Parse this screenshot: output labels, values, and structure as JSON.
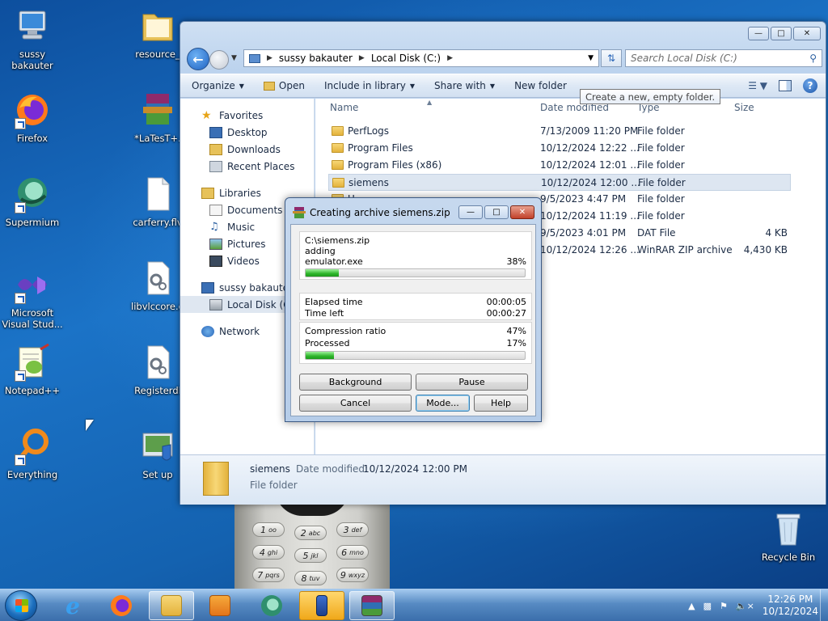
{
  "desktop": {
    "icons": [
      {
        "label": "sussy bakauter",
        "icon": "computer-icon"
      },
      {
        "label": "resource_",
        "icon": "folder-icon"
      },
      {
        "label": "Firefox",
        "icon": "firefox-icon"
      },
      {
        "label": "*LaTesT+.",
        "icon": "winrar-archive-icon"
      },
      {
        "label": "Supermium",
        "icon": "supermium-icon"
      },
      {
        "label": "carferry.flv",
        "icon": "file-icon"
      },
      {
        "label": "Microsoft Visual Stud...",
        "icon": "visual-studio-icon"
      },
      {
        "label": "libvlccore.d",
        "icon": "dll-file-icon"
      },
      {
        "label": "Notepad++",
        "icon": "notepadpp-icon"
      },
      {
        "label": "Registerdl",
        "icon": "dll-file-icon"
      },
      {
        "label": "Everything",
        "icon": "everything-icon"
      },
      {
        "label": "Set up",
        "icon": "setup-icon"
      },
      {
        "label": "Recycle Bin",
        "icon": "recycle-bin-icon"
      }
    ]
  },
  "explorer": {
    "address": {
      "crumbs": [
        "sussy bakauter",
        "Local Disk (C:)"
      ]
    },
    "search_placeholder": "Search Local Disk (C:)",
    "toolbar": {
      "organize": "Organize",
      "open": "Open",
      "include": "Include in library",
      "share": "Share with",
      "new_folder": "New folder"
    },
    "tooltip": "Create a new, empty folder.",
    "nav": {
      "favorites": "Favorites",
      "desktop": "Desktop",
      "downloads": "Downloads",
      "recent": "Recent Places",
      "libraries": "Libraries",
      "documents": "Documents",
      "music": "Music",
      "pictures": "Pictures",
      "videos": "Videos",
      "computer": "sussy bakauter",
      "localdisk": "Local Disk (C:",
      "network": "Network"
    },
    "columns": {
      "name": "Name",
      "date": "Date modified",
      "type": "Type",
      "size": "Size"
    },
    "files": [
      {
        "name": "PerfLogs",
        "date": "7/13/2009 11:20 PM",
        "type": "File folder",
        "size": ""
      },
      {
        "name": "Program Files",
        "date": "10/12/2024 12:22 ...",
        "type": "File folder",
        "size": ""
      },
      {
        "name": "Program Files (x86)",
        "date": "10/12/2024 12:01 ...",
        "type": "File folder",
        "size": ""
      },
      {
        "name": "siemens",
        "date": "10/12/2024 12:00 ...",
        "type": "File folder",
        "size": ""
      },
      {
        "name": "U",
        "date": "9/5/2023 4:47 PM",
        "type": "File folder",
        "size": ""
      },
      {
        "name": "",
        "date": "10/12/2024 11:19 ...",
        "type": "File folder",
        "size": ""
      },
      {
        "name": "",
        "date": "9/5/2023 4:01 PM",
        "type": "DAT File",
        "size": "4 KB"
      },
      {
        "name": "",
        "date": "10/12/2024 12:26 ...",
        "type": "WinRAR ZIP archive",
        "size": "4,430 KB"
      }
    ],
    "details": {
      "name": "siemens",
      "date_label": "Date modified:",
      "date": "10/12/2024 12:00 PM",
      "type": "File folder"
    }
  },
  "winrar": {
    "title": "Creating archive siemens.zip",
    "path": "C:\\siemens.zip",
    "action": "adding",
    "file": "emulator.exe",
    "file_percent": "38%",
    "file_progress": 0.15,
    "elapsed_label": "Elapsed time",
    "elapsed": "00:00:05",
    "left_label": "Time left",
    "left": "00:00:27",
    "ratio_label": "Compression ratio",
    "ratio": "47%",
    "processed_label": "Processed",
    "processed": "17%",
    "processed_progress": 0.13,
    "buttons": {
      "background": "Background",
      "pause": "Pause",
      "cancel": "Cancel",
      "mode": "Mode...",
      "help": "Help"
    }
  },
  "phone_keys": [
    {
      "num": "1",
      "sub": "oo"
    },
    {
      "num": "2",
      "sub": "abc"
    },
    {
      "num": "3",
      "sub": "def"
    },
    {
      "num": "4",
      "sub": "ghi"
    },
    {
      "num": "5",
      "sub": "jkl"
    },
    {
      "num": "6",
      "sub": "mno"
    },
    {
      "num": "7",
      "sub": "pqrs"
    },
    {
      "num": "8",
      "sub": "tuv"
    },
    {
      "num": "9",
      "sub": "wxyz"
    }
  ],
  "taskbar": {
    "clock_time": "12:26 PM",
    "clock_date": "10/12/2024"
  }
}
